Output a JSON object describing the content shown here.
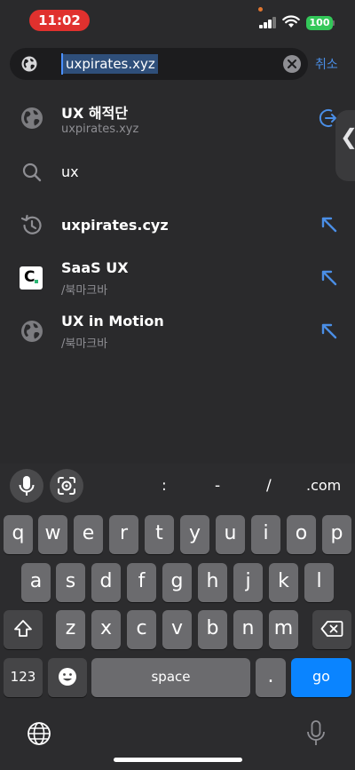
{
  "status_bar": {
    "time": "11:02",
    "battery": "100"
  },
  "address_bar": {
    "url": "uxpirates.xyz",
    "cancel_label": "취소"
  },
  "suggestions": [
    {
      "title": "UX 해적단",
      "subtitle": "uxpirates.xyz",
      "icon": "globe-icon",
      "action": "switch-tab-icon"
    },
    {
      "title": "ux",
      "subtitle": "",
      "icon": "search-icon",
      "action": ""
    },
    {
      "title": "uxpirates.cyz",
      "subtitle": "",
      "icon": "history-icon",
      "action": "fill-arrow-icon"
    },
    {
      "title": "SaaS UX",
      "subtitle": "/북마크바",
      "icon": "saas-logo",
      "action": "fill-arrow-icon"
    },
    {
      "title": "UX in Motion",
      "subtitle": "/북마크바",
      "icon": "globe-icon",
      "action": "fill-arrow-icon"
    }
  ],
  "keyboard": {
    "toolbar_keys": [
      ":",
      "-",
      "/",
      ".com"
    ],
    "row1": [
      "q",
      "w",
      "e",
      "r",
      "t",
      "y",
      "u",
      "i",
      "o",
      "p"
    ],
    "row2": [
      "a",
      "s",
      "d",
      "f",
      "g",
      "h",
      "j",
      "k",
      "l"
    ],
    "row3": [
      "z",
      "x",
      "c",
      "v",
      "b",
      "n",
      "m"
    ],
    "numbers_label": "123",
    "space_label": "space",
    "period_label": ".",
    "go_label": "go"
  },
  "colors": {
    "accent": "#4a8ee6",
    "go_key": "#0a84ff",
    "time_pill": "#e0312e",
    "battery": "#33c759"
  }
}
